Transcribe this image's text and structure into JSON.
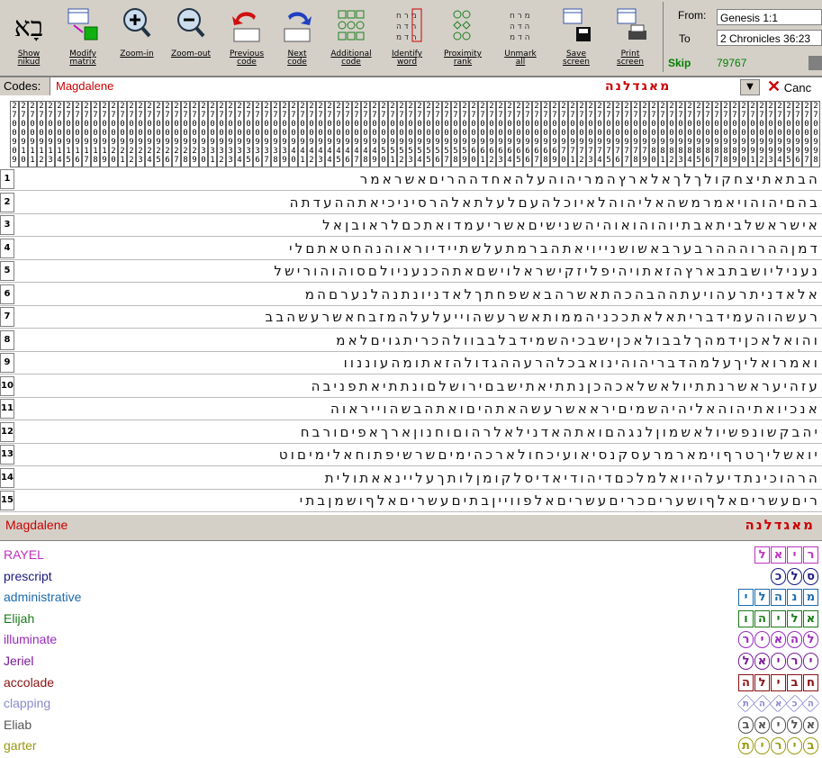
{
  "toolbar": {
    "buttons": [
      {
        "label": "Show\nnikud",
        "icon": "nikud-icon"
      },
      {
        "label": "Modify\nmatrix",
        "icon": "matrix-icon"
      },
      {
        "label": "Zoom-in",
        "icon": "zoom-in-icon"
      },
      {
        "label": "Zoom-out",
        "icon": "zoom-out-icon"
      },
      {
        "label": "Previous\ncode",
        "icon": "previous-code-icon"
      },
      {
        "label": "Next\ncode",
        "icon": "next-code-icon"
      },
      {
        "label": "Additional\ncode",
        "icon": "additional-code-icon"
      },
      {
        "label": "Identify\nword",
        "icon": "identify-word-icon"
      },
      {
        "label": "Proximity\nrank",
        "icon": "proximity-rank-icon"
      },
      {
        "label": "Unmark\nall",
        "icon": "unmark-all-icon"
      },
      {
        "label": "Save\nscreen",
        "icon": "save-icon"
      },
      {
        "label": "Print\nscreen",
        "icon": "print-icon"
      }
    ],
    "from_label": "From:",
    "from_value": "Genesis 1:1",
    "to_label": "To",
    "to_value": "2 Chronicles 36:23",
    "skip_label": "Skip",
    "skip_value": "79767"
  },
  "codes": {
    "label": "Codes:",
    "value": "Magdalene",
    "hebrew": "מאגדלנה",
    "cancel": "Canc"
  },
  "grid": {
    "column_headers": [
      "2700998",
      "2700997",
      "2700996",
      "2700995",
      "2700994",
      "2700993",
      "2700992",
      "2700991",
      "2700990",
      "2700989",
      "2700988",
      "2700987",
      "2700986",
      "2700985",
      "2700984",
      "2700983",
      "2700982",
      "2700981",
      "2700980",
      "2700979",
      "2700978",
      "2700977",
      "2700976",
      "2700975",
      "2700974",
      "2700973",
      "2700972",
      "2700971",
      "2700970",
      "2700969",
      "2700968",
      "2700967",
      "2700966",
      "2700965",
      "2700964",
      "2700963",
      "2700962",
      "2700961",
      "2700960",
      "2700959",
      "2700958",
      "2700957",
      "2700956",
      "2700955",
      "2700954",
      "2700953",
      "2700952",
      "2700951",
      "2700950",
      "2700949",
      "2700948",
      "2700947",
      "2700946",
      "2700945",
      "2700944",
      "2700943",
      "2700942",
      "2700941",
      "2700940",
      "2700939",
      "2700938",
      "2700937",
      "2700936",
      "2700935",
      "2700934",
      "2700933",
      "2700932",
      "2700931",
      "2700930",
      "2700929",
      "2700928",
      "2700927",
      "2700926",
      "2700925",
      "2700924",
      "2700923",
      "2700922",
      "2700921",
      "2700920",
      "2700919",
      "2700918",
      "2700917",
      "2700916",
      "2700915",
      "2700914",
      "2700913",
      "2700912",
      "2700911",
      "2700910",
      "2700909"
    ],
    "rows": [
      {
        "n": "1",
        "text": "הבתאתיצחקולךלךאלארץהמריהוהעלהאחדההריםאשראמר"
      },
      {
        "n": "2",
        "text": "בהםיהוהויאמרמשהאליהוהלאיוכלהעםלעלתאלהרסיניכיאתההעדתה"
      },
      {
        "n": "3",
        "text": "אישראשלביתאבתיוהוהואוהיהשנישיםאשריעמדואתכםלראובןאל"
      },
      {
        "n": "4",
        "text": "דמןההרוהההרבערבאשושנייויאתהברמתעלשתיידיוראוהנהחטאתםלי"
      },
      {
        "n": "5",
        "text": "נעניליושבתבארץהזאתויהיפליזקישראלוישםאתהכנעניולםסוהוהורישל"
      },
      {
        "n": "6",
        "text": "אלאדניתרעהויעתההבהכהתאשרהבאשפחתךלאדניונתנהלנערםהמ"
      },
      {
        "n": "7",
        "text": "רעשהוהעמידבריתאלאתככניהממותאשרעשהוייעלעלהמזבחאשרעשהבב"
      },
      {
        "n": "8",
        "text": "והואלאכןידמהךלבבולאכןישבכיהשמידבלבבוולהכריתגויםלאמ"
      },
      {
        "n": "9",
        "text": "ואמרואליךעלמהדבריהוהינואבכלהרעההגדולהזאתומהעוננוו"
      },
      {
        "n": "10",
        "text": "עזהיעראשרנתתיולאשלאכהכןנתתיאתישבםירושלםונתתיאתפניבה"
      },
      {
        "n": "11",
        "text": "אנכיואתיהוהאליהיהשמיםיראאשרעשהאתהיםואתהבשהוייראוה"
      },
      {
        "n": "12",
        "text": "יהבקשונפשיולאשמוןלנגהםואתהאדנילאלרהוםוחנוןארךאפיםורבח"
      },
      {
        "n": "13",
        "text": "יואשליךטרףוימארמרעסקנסיאועיכחולארכהימיםשרשיפתוחאלימיםוט"
      },
      {
        "n": "14",
        "text": "הרהוכינתדיעלהיואלמלכםדיהודיאדיסלקומןלותךעליינאאתולית"
      },
      {
        "n": "15",
        "text": "ריםעשריםאלףושעריםכריםעשריםאלפווייןבתיםעשריםאלףושמןבתי"
      }
    ],
    "bottom_label": "Magdalene"
  },
  "terms": [
    {
      "word": "RAYEL",
      "color": "#c030c0",
      "glyphs": [
        "ר",
        "י",
        "א",
        "ל"
      ],
      "shape": "sq"
    },
    {
      "word": "prescript",
      "color": "#1a1a80",
      "glyphs": [
        "ס",
        "ל",
        "כ"
      ],
      "shape": "ci"
    },
    {
      "word": "administrative",
      "color": "#1a6ab0",
      "glyphs": [
        "מ",
        "נ",
        "ה",
        "ל",
        "י"
      ],
      "shape": "sq"
    },
    {
      "word": "Elijah",
      "color": "#1a7a1a",
      "glyphs": [
        "א",
        "ל",
        "י",
        "ה",
        "ו"
      ],
      "shape": "sq"
    },
    {
      "word": "illuminate",
      "color": "#9a2ac0",
      "glyphs": [
        "ל",
        "ה",
        "א",
        "י",
        "ר"
      ],
      "shape": "hx"
    },
    {
      "word": "Jeriel",
      "color": "#7a1a9a",
      "glyphs": [
        "י",
        "ר",
        "י",
        "א",
        "ל"
      ],
      "shape": "ci"
    },
    {
      "word": "accolade",
      "color": "#8a1010",
      "glyphs": [
        "ח",
        "ב",
        "י",
        "ל",
        "ה"
      ],
      "shape": "sq"
    },
    {
      "word": "clapping",
      "color": "#8a8ad0",
      "glyphs": [
        "ה",
        "כ",
        "א",
        "ה",
        "ת"
      ],
      "shape": "dm"
    },
    {
      "word": "Eliab",
      "color": "#555555",
      "glyphs": [
        "א",
        "ל",
        "י",
        "א",
        "ב"
      ],
      "shape": "hx"
    },
    {
      "word": "garter",
      "color": "#9a9a10",
      "glyphs": [
        "ב",
        "י",
        "ר",
        "י",
        "ת"
      ],
      "shape": "ci"
    }
  ],
  "colors": {
    "code_red": "#cc0000",
    "accent_green": "#008000"
  }
}
